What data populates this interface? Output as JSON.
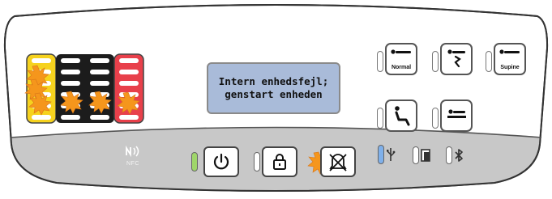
{
  "display": {
    "line1": "Intern enhedsfejl;",
    "line2": "genstart enheden"
  },
  "positions": {
    "normal_label": "Normal",
    "supine_label": "Supine"
  },
  "nfc": {
    "label": "NFC"
  },
  "colors": {
    "panel": "#ffffff",
    "lower_band": "#c8c8c8",
    "lcd": "#a9bbd9",
    "bar_yellow": "#f6d21e",
    "bar_black": "#1c1c1c",
    "bar_red": "#e8404b",
    "alert_orange": "#f5961c",
    "power_led": "#9fd66a",
    "usb_led": "#7fb0ea"
  },
  "icons": [
    "power-icon",
    "lock-icon",
    "alarm-mute-icon",
    "usb-icon",
    "battery-icon",
    "bluetooth-icon",
    "nfc-icon"
  ]
}
